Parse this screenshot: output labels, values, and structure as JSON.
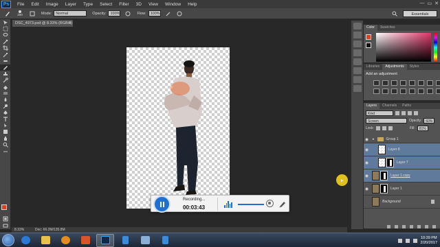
{
  "app": {
    "logo": "Ps"
  },
  "menu": [
    "File",
    "Edit",
    "Image",
    "Layer",
    "Type",
    "Select",
    "Filter",
    "3D",
    "View",
    "Window",
    "Help"
  ],
  "window_controls": {
    "minimize": "—",
    "restore": "▭",
    "close": "✕"
  },
  "options": {
    "brush_size": "200",
    "mode_label": "Mode:",
    "mode_value": "Normal",
    "opacity_label": "Opacity:",
    "opacity_value": "100%",
    "flow_label": "Flow:",
    "flow_value": "100%",
    "workspace": "Essentials"
  },
  "document": {
    "tab_title": "DSC_4973.psd @ 8.33% (RGB/8) *",
    "zoom": "8.33%",
    "doc_size": "Doc: 66.2M/135.8M"
  },
  "color_panel": {
    "tabs": [
      "Color",
      "Swatches"
    ],
    "fg": "#e0401a",
    "bg": "#111111"
  },
  "adjustments_panel": {
    "tabs": [
      "Libraries",
      "Adjustments",
      "Styles"
    ],
    "title": "Add an adjustment"
  },
  "layers_panel": {
    "tabs": [
      "Layers",
      "Channels",
      "Paths"
    ],
    "kind": "Kind",
    "blend_mode": "Screen",
    "opacity_label": "Opacity:",
    "opacity": "60%",
    "lock_label": "Lock:",
    "fill_label": "Fill:",
    "fill": "81%",
    "layers": [
      {
        "name": "Group 1",
        "type": "group"
      },
      {
        "name": "Layer 8",
        "type": "layer",
        "selected": true
      },
      {
        "name": "Layer 7",
        "type": "masked",
        "selected": true
      },
      {
        "name": "Layer 1 copy",
        "type": "masked",
        "selected": true
      },
      {
        "name": "Layer 1",
        "type": "masked",
        "selected": false
      },
      {
        "name": "Background",
        "type": "background",
        "selected": false
      }
    ]
  },
  "recorder": {
    "status": "Recording...",
    "time": "00:03:43"
  },
  "taskbar": {
    "time": "10:39 PM",
    "date": "2/20/2017"
  },
  "colors": {
    "accent": "#1f6fd1",
    "selection": "#5f7a9a",
    "cursor_highlight": "#f5d21a"
  }
}
